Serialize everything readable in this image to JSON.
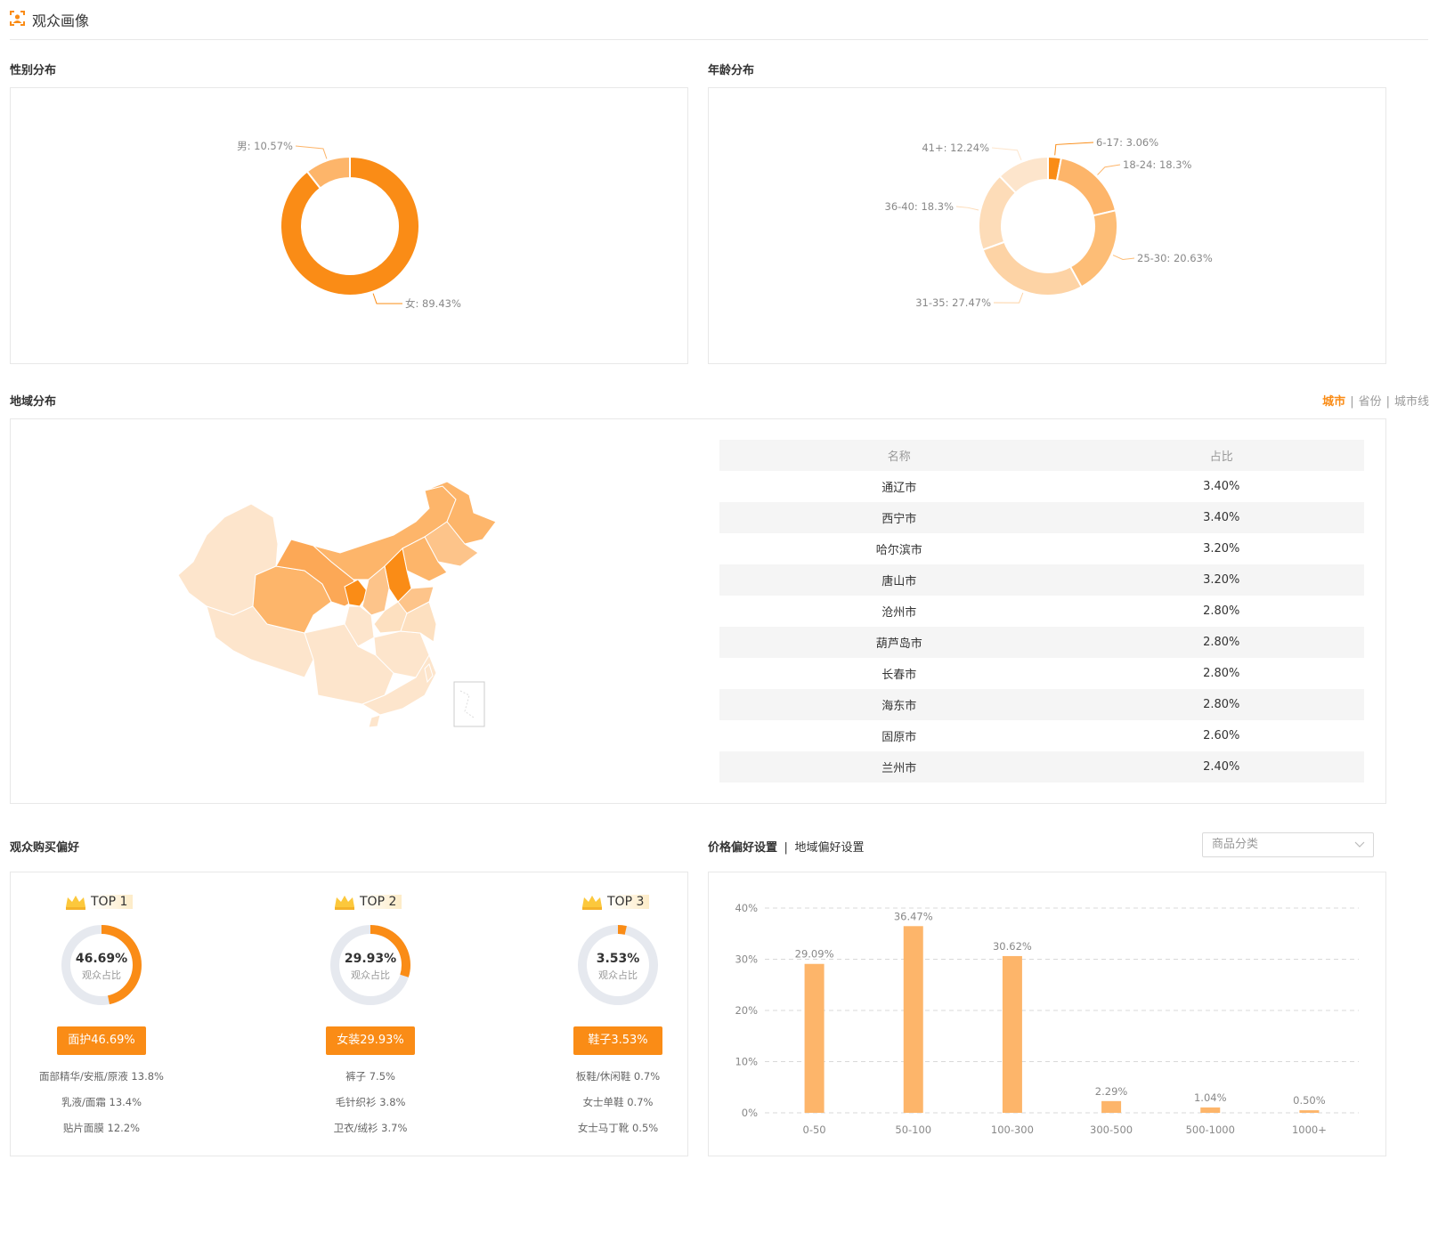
{
  "header": {
    "title": "观众画像",
    "icon": "portrait-icon"
  },
  "colors": {
    "accent": "#fa8c16",
    "light": "#fdb56a",
    "lighter": "#fdd3a5",
    "lightest": "#fde5cc",
    "track": "#e6e9ef"
  },
  "gender": {
    "title": "性别分布",
    "chart_data": {
      "type": "pie",
      "slices": [
        {
          "label": "女: 89.43%",
          "value": 89.43
        },
        {
          "label": "男: 10.57%",
          "value": 10.57
        }
      ]
    }
  },
  "age": {
    "title": "年龄分布",
    "chart_data": {
      "type": "pie",
      "slices": [
        {
          "label": "6-17: 3.06%",
          "value": 3.06
        },
        {
          "label": "18-24: 18.3%",
          "value": 18.3
        },
        {
          "label": "25-30: 20.63%",
          "value": 20.63
        },
        {
          "label": "31-35: 27.47%",
          "value": 27.47
        },
        {
          "label": "36-40: 18.3%",
          "value": 18.3
        },
        {
          "label": "41+: 12.24%",
          "value": 12.24
        }
      ]
    }
  },
  "region": {
    "title": "地域分布",
    "tabs": [
      "城市",
      "省份",
      "城市线"
    ],
    "active_tab": "城市",
    "table": {
      "headers": [
        "名称",
        "占比"
      ],
      "rows": [
        [
          "通辽市",
          "3.40%"
        ],
        [
          "西宁市",
          "3.40%"
        ],
        [
          "哈尔滨市",
          "3.20%"
        ],
        [
          "唐山市",
          "3.20%"
        ],
        [
          "沧州市",
          "2.80%"
        ],
        [
          "葫芦岛市",
          "2.80%"
        ],
        [
          "长春市",
          "2.80%"
        ],
        [
          "海东市",
          "2.80%"
        ],
        [
          "固原市",
          "2.60%"
        ],
        [
          "兰州市",
          "2.40%"
        ]
      ]
    }
  },
  "purchase": {
    "title": "观众购买偏好",
    "items": [
      {
        "badge": "TOP 1",
        "pct": "46.69%",
        "value": 46.69,
        "sub": "观众占比",
        "category": "面护46.69%",
        "subs": [
          "面部精华/安瓶/原液 13.8%",
          "乳液/面霜 13.4%",
          "贴片面膜 12.2%"
        ]
      },
      {
        "badge": "TOP 2",
        "pct": "29.93%",
        "value": 29.93,
        "sub": "观众占比",
        "category": "女装29.93%",
        "subs": [
          "裤子 7.5%",
          "毛针织衫 3.8%",
          "卫衣/绒衫 3.7%"
        ]
      },
      {
        "badge": "TOP 3",
        "pct": "3.53%",
        "value": 3.53,
        "sub": "观众占比",
        "category": "鞋子3.53%",
        "subs": [
          "板鞋/休闲鞋 0.7%",
          "女士单鞋 0.7%",
          "女士马丁靴 0.5%"
        ]
      }
    ]
  },
  "price": {
    "title_a": "价格偏好设置",
    "sep": "|",
    "title_b": "地域偏好设置",
    "select_placeholder": "商品分类",
    "chart_data": {
      "type": "bar",
      "categories": [
        "0-50",
        "50-100",
        "100-300",
        "300-500",
        "500-1000",
        "1000+"
      ],
      "values": [
        29.09,
        36.47,
        30.62,
        2.29,
        1.04,
        0.5
      ],
      "value_labels": [
        "29.09%",
        "36.47%",
        "30.62%",
        "2.29%",
        "1.04%",
        "0.50%"
      ],
      "yticks": [
        "0%",
        "10%",
        "20%",
        "30%",
        "40%"
      ],
      "ylim": [
        0,
        40
      ],
      "grid": true
    }
  }
}
